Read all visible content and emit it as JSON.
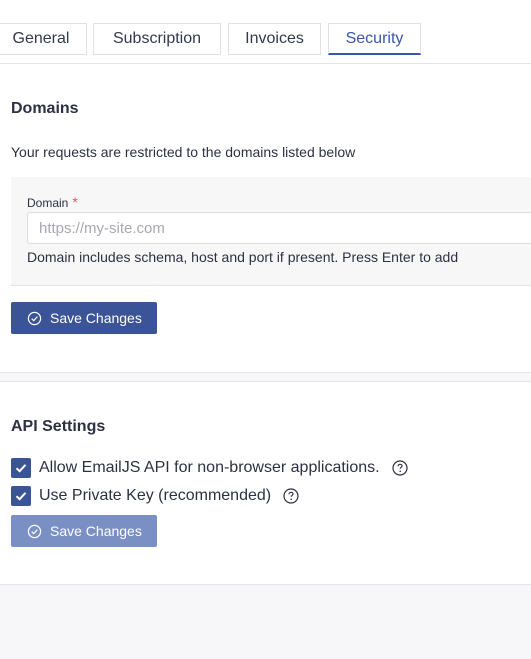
{
  "tabs": [
    {
      "label": "General"
    },
    {
      "label": "Subscription"
    },
    {
      "label": "Invoices"
    },
    {
      "label": "Security",
      "active": true
    }
  ],
  "domains": {
    "title": "Domains",
    "description": "Your requests are restricted to the domains listed below",
    "field_label": "Domain",
    "required_mark": "*",
    "placeholder": "https://my-site.com",
    "value": "",
    "hint": "Domain includes schema, host and port if present. Press Enter to add",
    "save_label": "Save Changes"
  },
  "api_settings": {
    "title": "API Settings",
    "options": [
      {
        "label": "Allow EmailJS API for non-browser applications.",
        "checked": true,
        "icon": "help-icon"
      },
      {
        "label": "Use Private Key (recommended)",
        "checked": true,
        "icon": "help-icon"
      }
    ],
    "save_label": "Save Changes",
    "save_disabled": true
  },
  "colors": {
    "accent": "#3b5498",
    "accent_disabled": "#7a8fc4",
    "required": "#e25563"
  }
}
